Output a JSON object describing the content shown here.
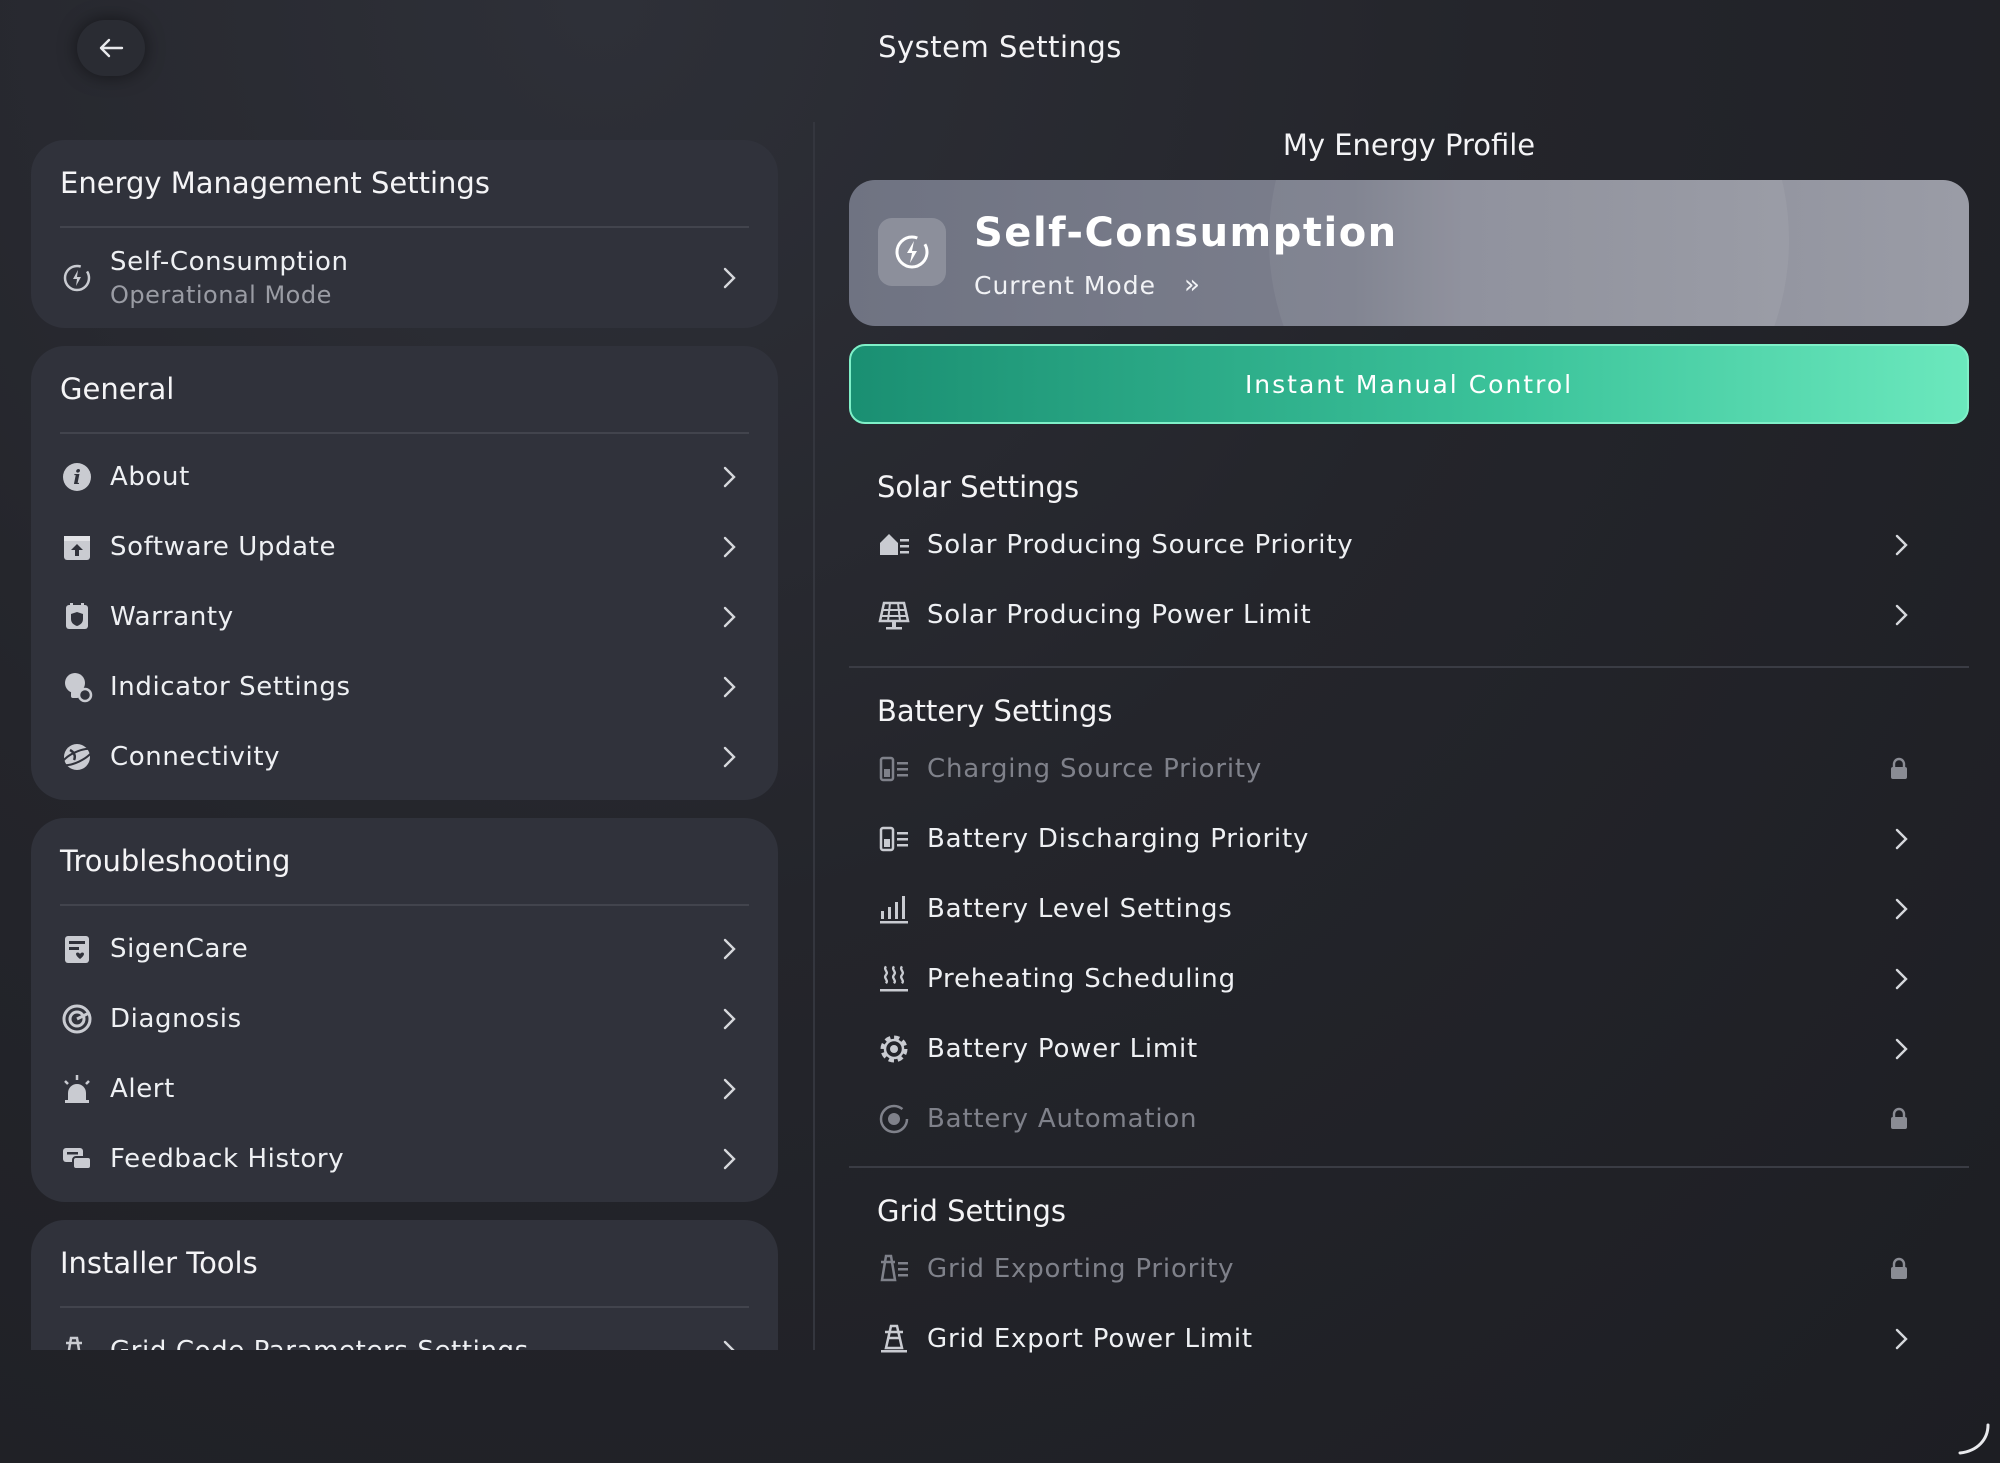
{
  "header": {
    "title": "System Settings"
  },
  "left": {
    "energy": {
      "title": "Energy Management Settings",
      "mode_label": "Self-Consumption",
      "mode_sub": "Operational Mode"
    },
    "general": {
      "title": "General",
      "items": [
        {
          "label": "About",
          "icon": "info-icon"
        },
        {
          "label": "Software Update",
          "icon": "upload-icon"
        },
        {
          "label": "Warranty",
          "icon": "shield-calendar-icon"
        },
        {
          "label": "Indicator Settings",
          "icon": "bulb-gear-icon"
        },
        {
          "label": "Connectivity",
          "icon": "globe-icon"
        }
      ]
    },
    "troubleshooting": {
      "title": "Troubleshooting",
      "items": [
        {
          "label": "SigenCare",
          "icon": "care-icon"
        },
        {
          "label": "Diagnosis",
          "icon": "diagnosis-icon"
        },
        {
          "label": "Alert",
          "icon": "alarm-icon"
        },
        {
          "label": "Feedback History",
          "icon": "chat-icon"
        }
      ]
    },
    "installer": {
      "title": "Installer Tools",
      "items": [
        {
          "label": "Grid Code Parameters Settings",
          "icon": "tower-gear-icon"
        }
      ]
    }
  },
  "right": {
    "profile_title": "My Energy Profile",
    "mode": {
      "name": "Self-Consumption",
      "sub": "Current Mode",
      "arrow": "»"
    },
    "manual_button": "Instant Manual Control",
    "solar": {
      "title": "Solar Settings",
      "items": [
        {
          "label": "Solar Producing Source Priority",
          "locked": false
        },
        {
          "label": "Solar Producing Power Limit",
          "locked": false
        }
      ]
    },
    "battery": {
      "title": "Battery Settings",
      "items": [
        {
          "label": "Charging Source Priority",
          "locked": true
        },
        {
          "label": "Battery Discharging Priority",
          "locked": false
        },
        {
          "label": "Battery Level Settings",
          "locked": false
        },
        {
          "label": "Preheating Scheduling",
          "locked": false
        },
        {
          "label": "Battery Power Limit",
          "locked": false
        },
        {
          "label": "Battery Automation",
          "locked": true
        }
      ]
    },
    "grid": {
      "title": "Grid Settings",
      "items": [
        {
          "label": "Grid Exporting Priority",
          "locked": true
        },
        {
          "label": "Grid Export Power Limit",
          "locked": false
        }
      ]
    }
  },
  "colors": {
    "accent_green": "#3cc49b",
    "card_bg": "#30323b",
    "page_bg": "#24252b"
  }
}
